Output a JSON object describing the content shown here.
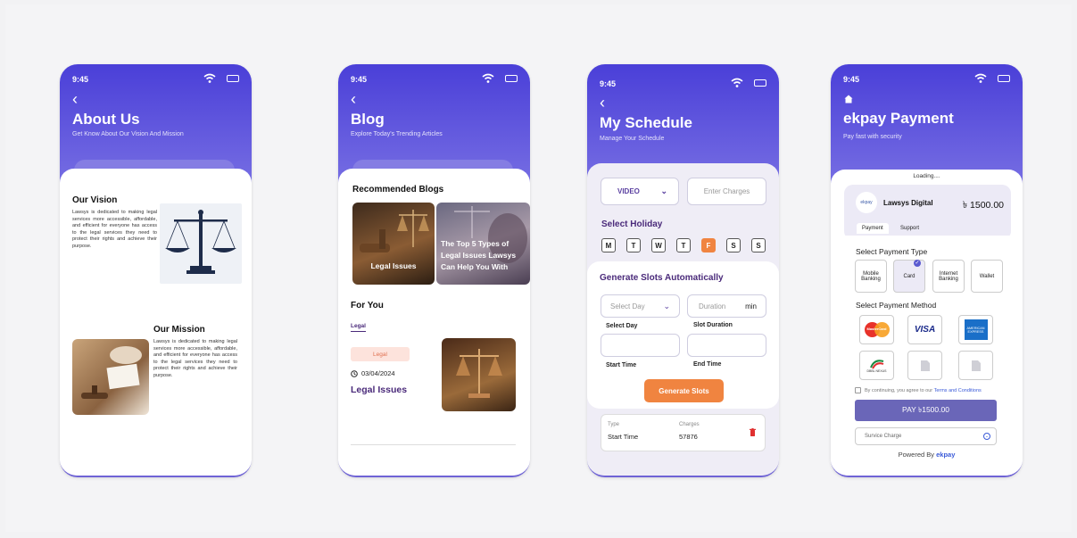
{
  "status_time": "9:45",
  "about": {
    "title": "About Us",
    "subtitle": "Get Know About Our Vision And Mission",
    "vision_title": "Our Vision",
    "vision_text": "Lawsys is dedicated to making legal services more accessible, affordable, and efficient for everyone has access to the legal services they need to protect their rights and achieve their purpose.",
    "mission_title": "Our Mission",
    "mission_text": "Lawsys is dedicated to making legal services more accessible, affordable, and efficient for everyone has access to the legal services they need to protect their rights and achieve their purpose."
  },
  "blog": {
    "title": "Blog",
    "subtitle": "Explore Today's Trending Articles",
    "recommended_title": "Recommended Blogs",
    "card1": "Legal Issues",
    "card2": "The Top 5 Types of Legal Issues Lawsys Can Help You With",
    "for_you_title": "For You",
    "tab": "Legal",
    "badge": "Legal",
    "date": "03/04/2024",
    "article_title": "Legal Issues"
  },
  "schedule": {
    "title": "My Schedule",
    "subtitle": "Manage Your Schedule",
    "type_select": "VIDEO",
    "charges_placeholder": "Enter Charges",
    "holiday_title": "Select Holiday",
    "days": [
      "M",
      "T",
      "W",
      "T",
      "F",
      "S",
      "S"
    ],
    "generate_title": "Generate Slots Automatically",
    "select_day_placeholder": "Select Day",
    "duration_placeholder": "Duration",
    "duration_unit": "min",
    "select_day_label": "Select Day",
    "slot_duration_label": "Slot Duration",
    "start_time_label": "Start Time",
    "end_time_label": "End Time",
    "generate_button": "Generate Slots",
    "type_label": "Type",
    "type_value": "Start Time",
    "charges_label": "Charges",
    "charges_value": "57876"
  },
  "payment": {
    "title": "ekpay Payment",
    "subtitle": "Pay fast with security",
    "loading": "Loading....",
    "logo_text": "ekpay",
    "merchant": "Lawsys Digital",
    "amount": "৳ 1500.00",
    "tab_payment": "Payment",
    "tab_support": "Support",
    "type_title": "Select Payment Type",
    "types": [
      "Mobile Banking",
      "Card",
      "Internet Banking",
      "Wallet"
    ],
    "method_title": "Select Payment Method",
    "mastercard": "MasterCard",
    "visa": "VISA",
    "amex": "AMERICAN EXPRESS",
    "nexus": "DBBL NEXUS",
    "terms_prefix": "By continuing, you agree to our ",
    "terms_link": "Terms and Conditions",
    "pay_button": "PAY ৳1500.00",
    "service_charge": "Survice Charge",
    "powered_by": "Powered By",
    "powered_brand": "ekpay"
  }
}
